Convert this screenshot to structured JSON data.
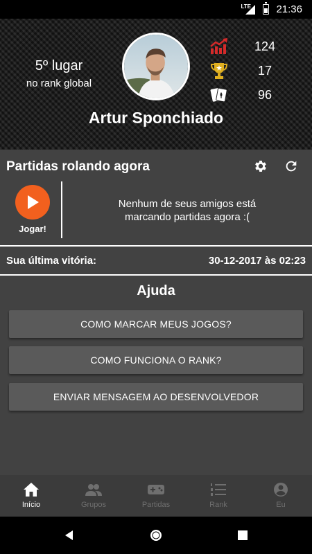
{
  "status_bar": {
    "network": "LTE",
    "time": "21:36"
  },
  "profile": {
    "rank_position": "5º lugar",
    "rank_scope": "no rank global",
    "name": "Artur Sponchiado",
    "stats": [
      {
        "icon": "trending-up-icon",
        "value": "124"
      },
      {
        "icon": "trophy-icon",
        "value": "17"
      },
      {
        "icon": "playing-cards-icon",
        "value": "96"
      }
    ]
  },
  "matches": {
    "title": "Partidas rolando agora",
    "play_label": "Jogar!",
    "empty_message_line1": "Nenhum de seus amigos está",
    "empty_message_line2": "marcando partidas agora :("
  },
  "last_win": {
    "label": "Sua última vitória:",
    "value": "30-12-2017 às 02:23"
  },
  "help": {
    "title": "Ajuda",
    "buttons": [
      "COMO MARCAR MEUS JOGOS?",
      "COMO FUNCIONA O RANK?",
      "ENVIAR MENSAGEM AO DESENVOLVEDOR"
    ]
  },
  "bottom_nav": [
    {
      "label": "Início",
      "icon": "home-icon",
      "active": true
    },
    {
      "label": "Grupos",
      "icon": "group-icon",
      "active": false
    },
    {
      "label": "Partidas",
      "icon": "gamepad-icon",
      "active": false
    },
    {
      "label": "Rank",
      "icon": "ranked-list-icon",
      "active": false
    },
    {
      "label": "Eu",
      "icon": "account-icon",
      "active": false
    }
  ],
  "colors": {
    "background": "#424242",
    "accent_orange": "#f2601e",
    "stat_icon_red": "#d42a2a",
    "stat_icon_gold": "#e0b020",
    "button": "#5a5a5a"
  }
}
